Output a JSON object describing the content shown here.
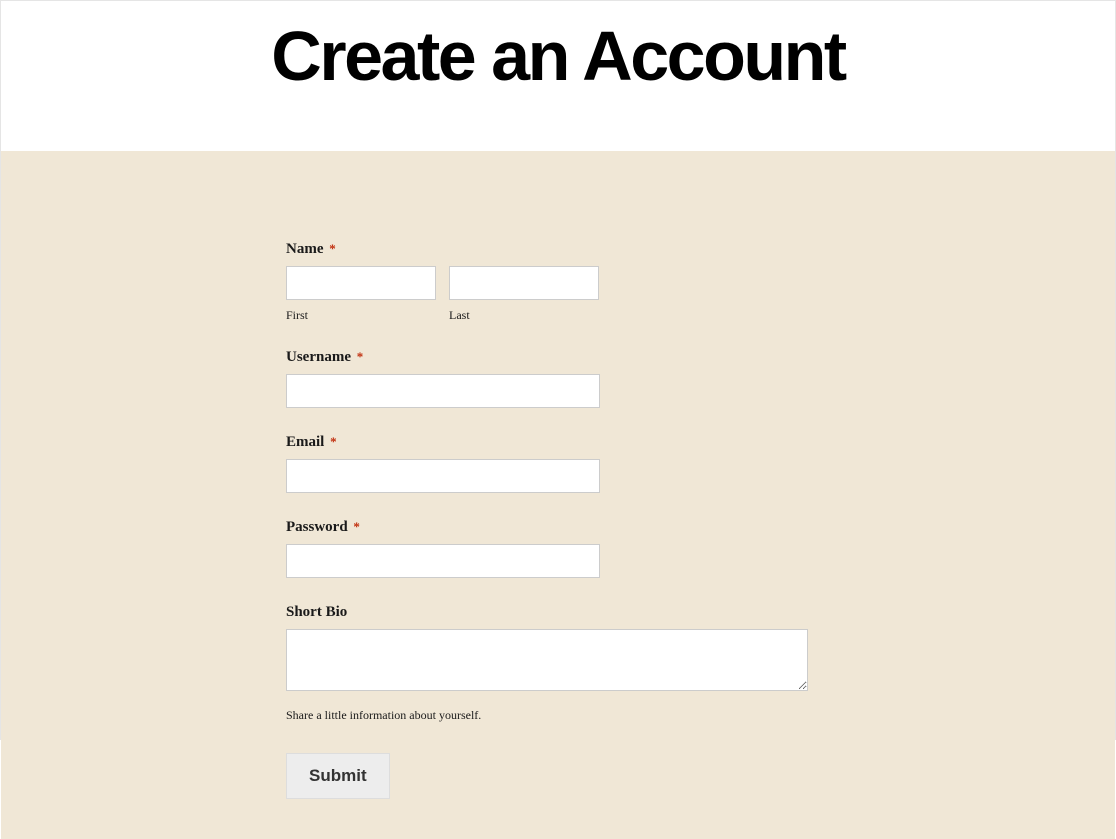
{
  "header": {
    "title": "Create an Account"
  },
  "form": {
    "name": {
      "label": "Name",
      "required": "*",
      "first_sublabel": "First",
      "last_sublabel": "Last",
      "first_value": "",
      "last_value": ""
    },
    "username": {
      "label": "Username",
      "required": "*",
      "value": ""
    },
    "email": {
      "label": "Email",
      "required": "*",
      "value": ""
    },
    "password": {
      "label": "Password",
      "required": "*",
      "value": ""
    },
    "bio": {
      "label": "Short Bio",
      "value": "",
      "helper": "Share a little information about yourself."
    },
    "submit": {
      "label": "Submit"
    }
  }
}
